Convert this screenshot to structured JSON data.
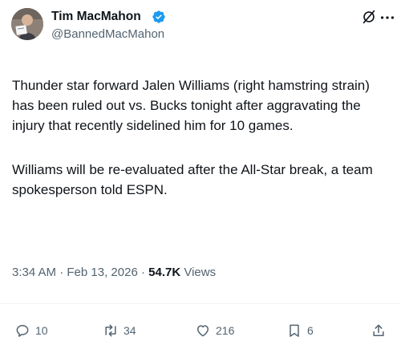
{
  "author": {
    "name": "Tim MacMahon",
    "handle": "@BannedMacMahon",
    "verified": true
  },
  "header_icons": [
    "grok-icon",
    "more-icon"
  ],
  "body": {
    "paragraphs": [
      "Thunder star forward Jalen Williams (right hamstring strain) has been ruled out vs. Bucks tonight after aggravating the injury that recently sidelined him for 10 games.",
      "Williams will be re-evaluated after the All-Star break, a team spokesperson told ESPN."
    ]
  },
  "meta": {
    "time": "3:34 AM",
    "date": "Feb 13, 2026",
    "separator": "·",
    "views_count": "54.7K",
    "views_label": "Views"
  },
  "actions": {
    "replies": "10",
    "reposts": "34",
    "likes": "216",
    "bookmarks": "6"
  },
  "colors": {
    "text": "#0f1419",
    "secondary": "#536471",
    "verified": "#1d9bf0",
    "divider": "#eff3f4"
  }
}
